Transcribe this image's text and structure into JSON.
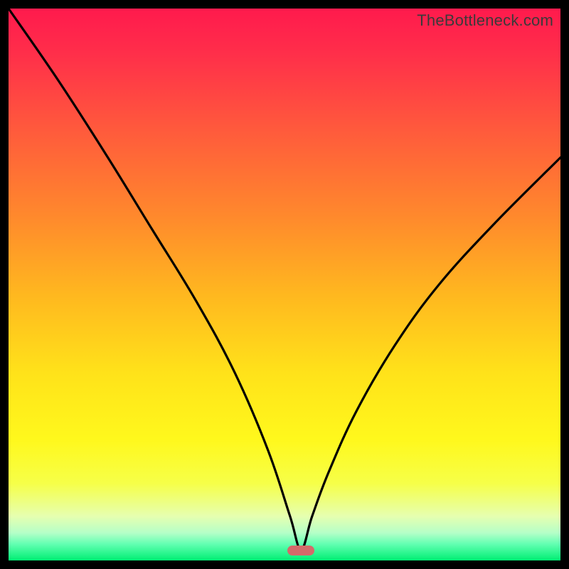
{
  "watermark": "TheBottleneck.com",
  "marker": {
    "x_pct": 53,
    "y_pct": 98.2
  },
  "chart_data": {
    "type": "line",
    "title": "",
    "xlabel": "",
    "ylabel": "",
    "xlim": [
      0,
      100
    ],
    "ylim": [
      0,
      100
    ],
    "series": [
      {
        "name": "bottleneck-curve",
        "x": [
          0,
          9,
          18,
          26,
          34,
          41,
          47,
          51,
          53,
          55,
          58,
          63,
          70,
          78,
          88,
          100
        ],
        "values": [
          100,
          87,
          73,
          60,
          47,
          34,
          20,
          8,
          2,
          8,
          16,
          27,
          39,
          50,
          61,
          73
        ]
      }
    ],
    "gradient_stops": [
      {
        "pos": 0,
        "color": "#ff1a4d"
      },
      {
        "pos": 8,
        "color": "#ff2e4a"
      },
      {
        "pos": 22,
        "color": "#ff5a3c"
      },
      {
        "pos": 38,
        "color": "#ff8a2c"
      },
      {
        "pos": 52,
        "color": "#ffb81f"
      },
      {
        "pos": 66,
        "color": "#ffe21a"
      },
      {
        "pos": 78,
        "color": "#fff81c"
      },
      {
        "pos": 86,
        "color": "#f6ff48"
      },
      {
        "pos": 92,
        "color": "#e6ffb0"
      },
      {
        "pos": 95,
        "color": "#b5ffc8"
      },
      {
        "pos": 97,
        "color": "#63ffb2"
      },
      {
        "pos": 100,
        "color": "#00ef73"
      }
    ],
    "marker_color": "#d46a6a"
  }
}
